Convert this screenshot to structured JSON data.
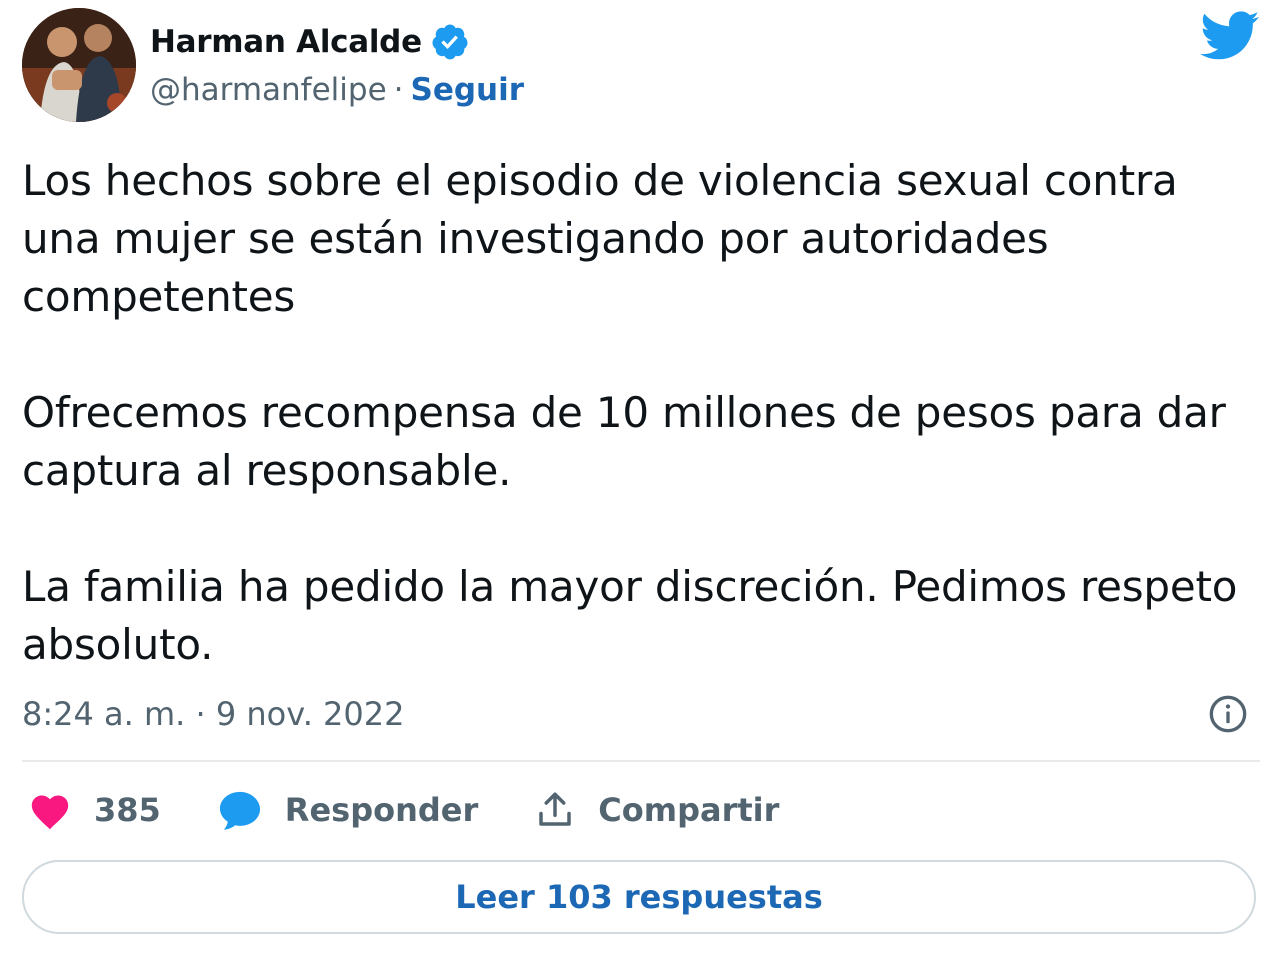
{
  "author": {
    "display_name": "Harman Alcalde",
    "handle": "@harmanfelipe",
    "separator": "·",
    "follow_label": "Seguir",
    "verified_icon": "verified-badge-icon"
  },
  "brand": {
    "logo_icon": "twitter-bird-icon",
    "accent_color": "#1d9bf0"
  },
  "tweet": {
    "paragraphs": [
      "Los hechos sobre el episodio de violencia sexual contra una mujer se están investigando por autoridades competentes",
      "Ofrecemos recompensa de 10 millones de pesos para dar captura al responsable.",
      "La familia ha pedido la mayor discreción. Pedimos respeto absoluto."
    ],
    "timestamp": "8:24 a. m. · 9 nov. 2022"
  },
  "actions": {
    "like_count": "385",
    "like_color": "#f91880",
    "reply_label": "Responder",
    "share_label": "Compartir"
  },
  "replies_button_label": "Leer 103 respuestas"
}
